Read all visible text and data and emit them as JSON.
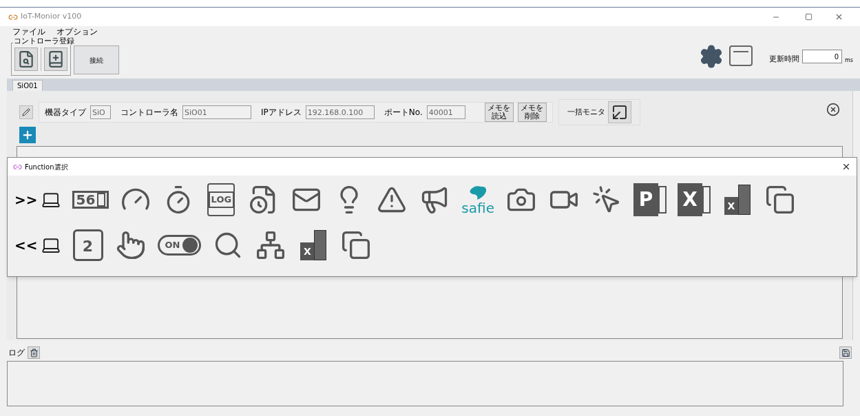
{
  "window": {
    "title": "IoT-Monior v100"
  },
  "menu": [
    "ファイル",
    "オプション"
  ],
  "controller_group": {
    "legend": "コントローラ登録"
  },
  "connect_button": "接続",
  "update_time": {
    "label": "更新時間",
    "value": "0",
    "unit": "ms"
  },
  "tabs": [
    {
      "label": "SiO01",
      "selected": true
    }
  ],
  "device": {
    "fields": [
      {
        "label": "機器タイプ",
        "value": "SiO"
      },
      {
        "label": "コントローラ名",
        "value": "SiO01"
      },
      {
        "label": "IPアドレス",
        "value": "192.168.0.100"
      },
      {
        "label": "ポートNo.",
        "value": "40001"
      }
    ],
    "memo_buttons": [
      {
        "lines": [
          "メモを",
          "読込"
        ]
      },
      {
        "lines": [
          "メモを",
          "削除"
        ]
      }
    ],
    "bulk_monitor_label": "一括モニタ"
  },
  "log": {
    "label": "ログ"
  },
  "dialog": {
    "title": "Function選択",
    "rows": [
      [
        {
          "kind": "send-pc",
          "label": ">>"
        },
        {
          "kind": "counter",
          "label": "56"
        },
        {
          "kind": "gauge"
        },
        {
          "kind": "timer"
        },
        {
          "kind": "log",
          "label": "LOG"
        },
        {
          "kind": "file-clock"
        },
        {
          "kind": "mail"
        },
        {
          "kind": "lamp"
        },
        {
          "kind": "alert"
        },
        {
          "kind": "megaphone"
        },
        {
          "kind": "safie",
          "label": "safie"
        },
        {
          "kind": "camera"
        },
        {
          "kind": "video"
        },
        {
          "kind": "browser"
        },
        {
          "kind": "powerpoint",
          "label": "P"
        },
        {
          "kind": "excel-video",
          "label": "X"
        },
        {
          "kind": "excel-book",
          "label": "X"
        },
        {
          "kind": "export"
        }
      ],
      [
        {
          "kind": "receive-pc",
          "label": "<<"
        },
        {
          "kind": "calendar",
          "label": "2"
        },
        {
          "kind": "touch"
        },
        {
          "kind": "switch",
          "label": "ON"
        },
        {
          "kind": "barcode"
        },
        {
          "kind": "tree"
        },
        {
          "kind": "book-excel",
          "label": "X"
        },
        {
          "kind": "import"
        }
      ]
    ]
  }
}
